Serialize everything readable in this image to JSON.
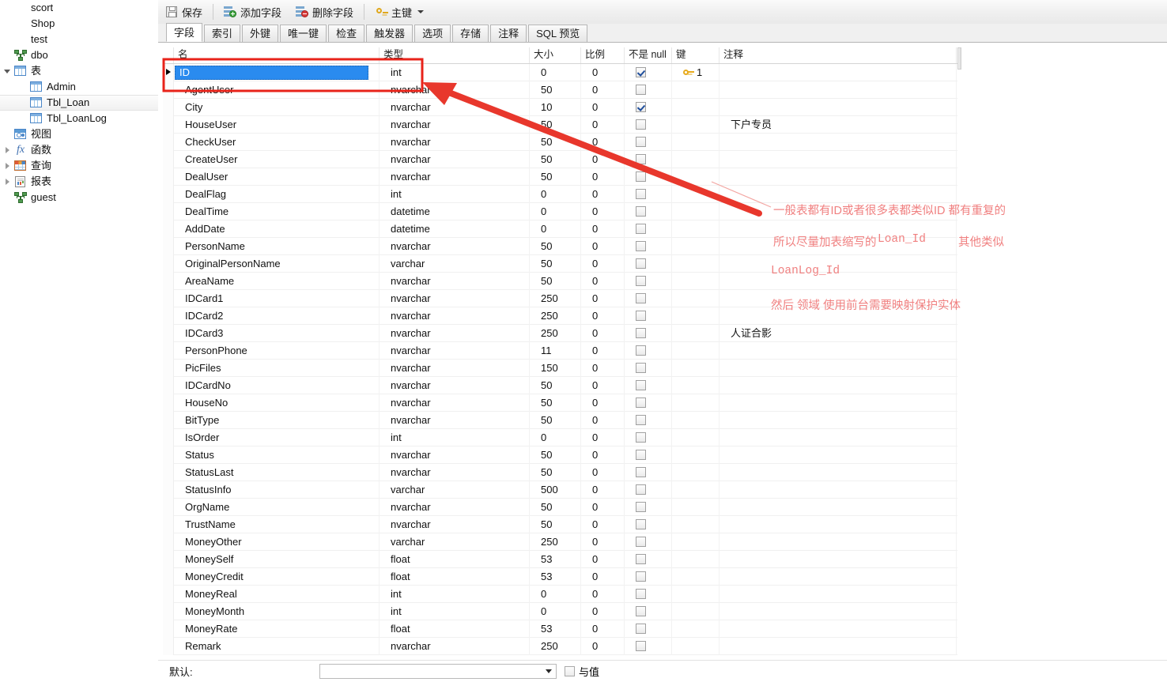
{
  "sidebar": {
    "items": [
      {
        "label": "scort",
        "icon": "none",
        "indent": 0,
        "expander": "none",
        "selected": false
      },
      {
        "label": "Shop",
        "icon": "none",
        "indent": 0,
        "expander": "none",
        "selected": false
      },
      {
        "label": "test",
        "icon": "none",
        "indent": 0,
        "expander": "none",
        "selected": false
      },
      {
        "label": "dbo",
        "icon": "server-icon",
        "indent": 0,
        "expander": "none",
        "selected": false
      },
      {
        "label": "表",
        "icon": "table-folder-icon",
        "indent": 0,
        "expander": "open",
        "selected": false
      },
      {
        "label": "Admin",
        "icon": "table-icon",
        "indent": 1,
        "expander": "none",
        "selected": false
      },
      {
        "label": "Tbl_Loan",
        "icon": "table-icon",
        "indent": 1,
        "expander": "none",
        "selected": true
      },
      {
        "label": "Tbl_LoanLog",
        "icon": "table-icon",
        "indent": 1,
        "expander": "none",
        "selected": false
      },
      {
        "label": "视图",
        "icon": "view-icon",
        "indent": 0,
        "expander": "none",
        "selected": false
      },
      {
        "label": "函数",
        "icon": "function-icon",
        "indent": 0,
        "expander": "closed",
        "selected": false
      },
      {
        "label": "查询",
        "icon": "query-icon",
        "indent": 0,
        "expander": "closed",
        "selected": false
      },
      {
        "label": "报表",
        "icon": "report-icon",
        "indent": 0,
        "expander": "closed",
        "selected": false
      },
      {
        "label": "guest",
        "icon": "server-icon",
        "indent": 0,
        "expander": "none",
        "selected": false
      }
    ]
  },
  "toolbar": {
    "save_label": "保存",
    "add_field_label": "添加字段",
    "delete_field_label": "删除字段",
    "primary_key_label": "主键"
  },
  "tabs": [
    {
      "label": "字段",
      "active": true
    },
    {
      "label": "索引",
      "active": false
    },
    {
      "label": "外键",
      "active": false
    },
    {
      "label": "唯一键",
      "active": false
    },
    {
      "label": "检查",
      "active": false
    },
    {
      "label": "触发器",
      "active": false
    },
    {
      "label": "选项",
      "active": false
    },
    {
      "label": "存储",
      "active": false
    },
    {
      "label": "注释",
      "active": false
    },
    {
      "label": "SQL 预览",
      "active": false
    }
  ],
  "grid": {
    "columns": [
      "名",
      "类型",
      "大小",
      "比例",
      "不是 null",
      "键",
      "注释"
    ],
    "rows": [
      {
        "name": "ID",
        "type": "int",
        "size": "0",
        "scale": "0",
        "notnull": true,
        "key": "1",
        "comment": "",
        "current": true,
        "editing": true
      },
      {
        "name": "AgentUser",
        "type": "nvarchar",
        "size": "50",
        "scale": "0",
        "notnull": false,
        "key": "",
        "comment": ""
      },
      {
        "name": "City",
        "type": "nvarchar",
        "size": "10",
        "scale": "0",
        "notnull": true,
        "key": "",
        "comment": ""
      },
      {
        "name": "HouseUser",
        "type": "nvarchar",
        "size": "50",
        "scale": "0",
        "notnull": false,
        "key": "",
        "comment": "下户专员"
      },
      {
        "name": "CheckUser",
        "type": "nvarchar",
        "size": "50",
        "scale": "0",
        "notnull": false,
        "key": "",
        "comment": ""
      },
      {
        "name": "CreateUser",
        "type": "nvarchar",
        "size": "50",
        "scale": "0",
        "notnull": false,
        "key": "",
        "comment": ""
      },
      {
        "name": "DealUser",
        "type": "nvarchar",
        "size": "50",
        "scale": "0",
        "notnull": false,
        "key": "",
        "comment": ""
      },
      {
        "name": "DealFlag",
        "type": "int",
        "size": "0",
        "scale": "0",
        "notnull": false,
        "key": "",
        "comment": ""
      },
      {
        "name": "DealTime",
        "type": "datetime",
        "size": "0",
        "scale": "0",
        "notnull": false,
        "key": "",
        "comment": ""
      },
      {
        "name": "AddDate",
        "type": "datetime",
        "size": "0",
        "scale": "0",
        "notnull": false,
        "key": "",
        "comment": ""
      },
      {
        "name": "PersonName",
        "type": "nvarchar",
        "size": "50",
        "scale": "0",
        "notnull": false,
        "key": "",
        "comment": ""
      },
      {
        "name": "OriginalPersonName",
        "type": "varchar",
        "size": "50",
        "scale": "0",
        "notnull": false,
        "key": "",
        "comment": ""
      },
      {
        "name": "AreaName",
        "type": "nvarchar",
        "size": "50",
        "scale": "0",
        "notnull": false,
        "key": "",
        "comment": ""
      },
      {
        "name": "IDCard1",
        "type": "nvarchar",
        "size": "250",
        "scale": "0",
        "notnull": false,
        "key": "",
        "comment": ""
      },
      {
        "name": "IDCard2",
        "type": "nvarchar",
        "size": "250",
        "scale": "0",
        "notnull": false,
        "key": "",
        "comment": ""
      },
      {
        "name": "IDCard3",
        "type": "nvarchar",
        "size": "250",
        "scale": "0",
        "notnull": false,
        "key": "",
        "comment": "人证合影"
      },
      {
        "name": "PersonPhone",
        "type": "nvarchar",
        "size": "11",
        "scale": "0",
        "notnull": false,
        "key": "",
        "comment": ""
      },
      {
        "name": "PicFiles",
        "type": "nvarchar",
        "size": "150",
        "scale": "0",
        "notnull": false,
        "key": "",
        "comment": ""
      },
      {
        "name": "IDCardNo",
        "type": "nvarchar",
        "size": "50",
        "scale": "0",
        "notnull": false,
        "key": "",
        "comment": ""
      },
      {
        "name": "HouseNo",
        "type": "nvarchar",
        "size": "50",
        "scale": "0",
        "notnull": false,
        "key": "",
        "comment": ""
      },
      {
        "name": "BitType",
        "type": "nvarchar",
        "size": "50",
        "scale": "0",
        "notnull": false,
        "key": "",
        "comment": ""
      },
      {
        "name": "IsOrder",
        "type": "int",
        "size": "0",
        "scale": "0",
        "notnull": false,
        "key": "",
        "comment": ""
      },
      {
        "name": "Status",
        "type": "nvarchar",
        "size": "50",
        "scale": "0",
        "notnull": false,
        "key": "",
        "comment": ""
      },
      {
        "name": "StatusLast",
        "type": "nvarchar",
        "size": "50",
        "scale": "0",
        "notnull": false,
        "key": "",
        "comment": ""
      },
      {
        "name": "StatusInfo",
        "type": "varchar",
        "size": "500",
        "scale": "0",
        "notnull": false,
        "key": "",
        "comment": ""
      },
      {
        "name": "OrgName",
        "type": "nvarchar",
        "size": "50",
        "scale": "0",
        "notnull": false,
        "key": "",
        "comment": ""
      },
      {
        "name": "TrustName",
        "type": "nvarchar",
        "size": "50",
        "scale": "0",
        "notnull": false,
        "key": "",
        "comment": ""
      },
      {
        "name": "MoneyOther",
        "type": "varchar",
        "size": "250",
        "scale": "0",
        "notnull": false,
        "key": "",
        "comment": ""
      },
      {
        "name": "MoneySelf",
        "type": "float",
        "size": "53",
        "scale": "0",
        "notnull": false,
        "key": "",
        "comment": ""
      },
      {
        "name": "MoneyCredit",
        "type": "float",
        "size": "53",
        "scale": "0",
        "notnull": false,
        "key": "",
        "comment": ""
      },
      {
        "name": "MoneyReal",
        "type": "int",
        "size": "0",
        "scale": "0",
        "notnull": false,
        "key": "",
        "comment": ""
      },
      {
        "name": "MoneyMonth",
        "type": "int",
        "size": "0",
        "scale": "0",
        "notnull": false,
        "key": "",
        "comment": ""
      },
      {
        "name": "MoneyRate",
        "type": "float",
        "size": "53",
        "scale": "0",
        "notnull": false,
        "key": "",
        "comment": ""
      },
      {
        "name": "Remark",
        "type": "nvarchar",
        "size": "250",
        "scale": "0",
        "notnull": false,
        "key": "",
        "comment": ""
      }
    ]
  },
  "bottom": {
    "default_label": "默认:",
    "default_value": "",
    "with_value_label": "与值"
  },
  "annotations": {
    "color": "#f08080",
    "line1": "一般表都有ID或者很多表都类似ID  都有重复的",
    "line2a": "所以尽量加表缩写的",
    "line2b": "Loan_Id",
    "line2c": "其他类似",
    "line3": "LoanLog_Id",
    "line4": "然后 领域 使用前台需要映射保护实体"
  }
}
